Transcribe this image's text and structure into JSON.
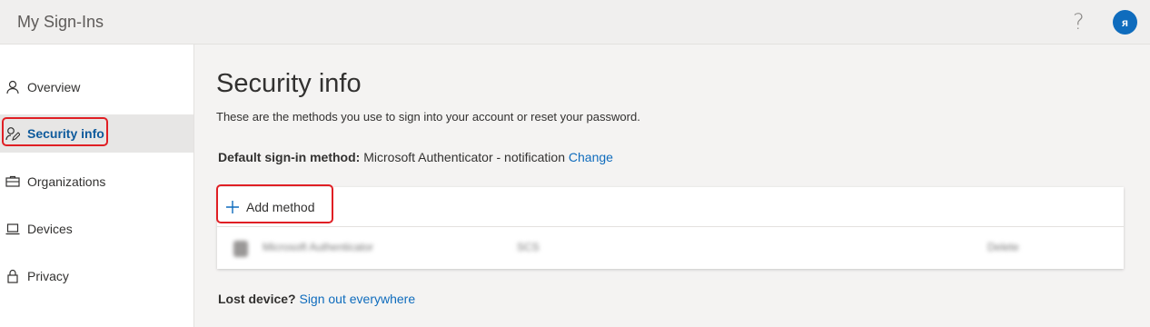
{
  "header": {
    "app_title": "My Sign-Ins",
    "help_glyph": "?",
    "avatar_initial": "ᴙ",
    "accent_color": "#0f6cbd"
  },
  "sidebar": {
    "items": [
      {
        "label": "Overview",
        "icon": "person-icon"
      },
      {
        "label": "Security info",
        "icon": "security-info-icon",
        "active": true
      },
      {
        "label": "Organizations",
        "icon": "briefcase-icon"
      },
      {
        "label": "Devices",
        "icon": "laptop-icon"
      },
      {
        "label": "Privacy",
        "icon": "lock-icon"
      }
    ]
  },
  "main": {
    "title": "Security info",
    "description": "These are the methods you use to sign into your account or reset your password.",
    "default_method": {
      "label": "Default sign-in method:",
      "value": "Microsoft Authenticator - notification",
      "change_link": "Change"
    },
    "add_method_label": "Add method",
    "methods": [
      {
        "name": "Microsoft Authenticator",
        "detail": "SCS",
        "action": "Delete"
      }
    ],
    "lost_device": {
      "label": "Lost device?",
      "link": "Sign out everywhere"
    }
  },
  "highlight_color": "#e01f24"
}
